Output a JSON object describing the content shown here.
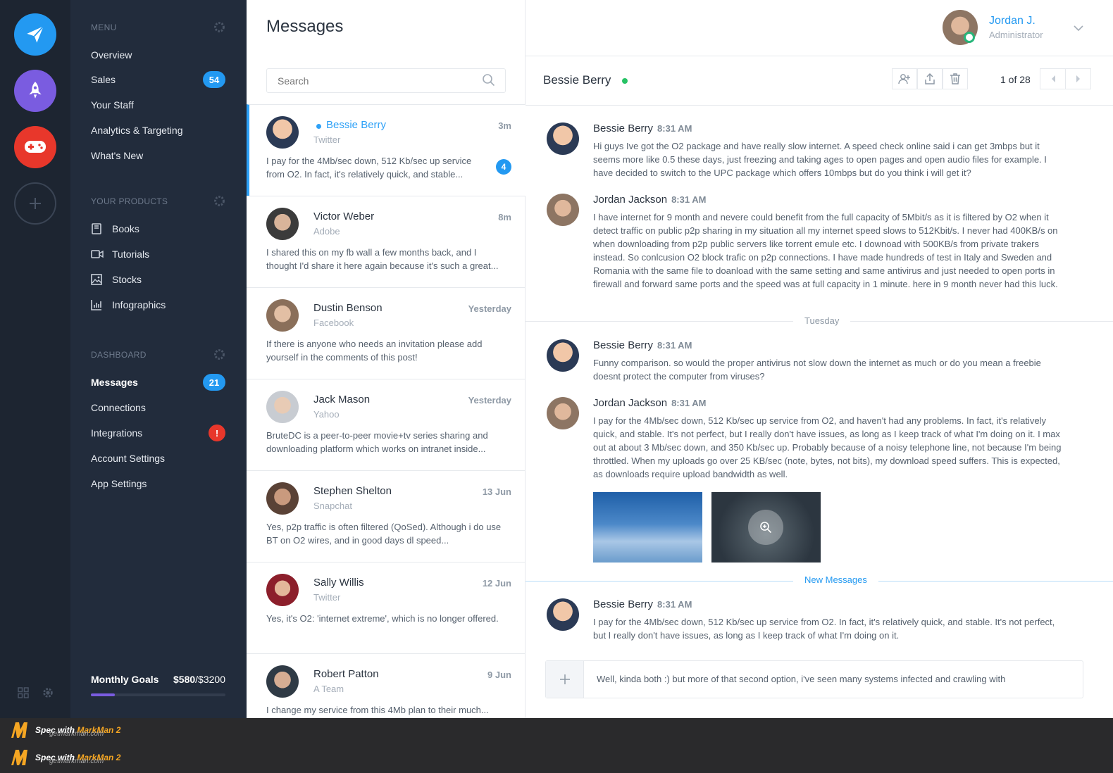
{
  "rail": {
    "buttons": [
      {
        "name": "send",
        "color": "#2399f1"
      },
      {
        "name": "rocket",
        "color": "#7a5ce0"
      },
      {
        "name": "gamepad",
        "color": "#e8372b"
      },
      {
        "name": "add"
      }
    ]
  },
  "nav": {
    "menu_header": "MENU",
    "menu_items": [
      "Overview",
      "Sales",
      "Your Staff",
      "Analytics & Targeting",
      "What's New"
    ],
    "sales_badge": "54",
    "products_header": "YOUR PRODUCTS",
    "product_items": [
      "Books",
      "Tutorials",
      "Stocks",
      "Infographics"
    ],
    "dashboard_header": "DASHBOARD",
    "dashboard_items": [
      "Messages",
      "Connections",
      "Integrations",
      "Account Settings",
      "App Settings"
    ],
    "messages_badge": "21",
    "integrations_badge": "!",
    "goals_label": "Monthly Goals",
    "goals_current": "$580",
    "goals_target": "/$3200",
    "goals_progress": 0.18
  },
  "list": {
    "title": "Messages",
    "search_placeholder": "Search",
    "conversations": [
      {
        "name": "Bessie Berry",
        "source": "Twitter",
        "time": "3m",
        "snippet": "I pay for the 4Mb/sec down, 512 Kb/sec up service from O2. In fact, it's relatively quick, and stable...",
        "count": "4"
      },
      {
        "name": "Victor Weber",
        "source": "Adobe",
        "time": "8m",
        "snippet": "I shared this on my fb wall a few months back, and I thought I'd share it here again because it's such a great..."
      },
      {
        "name": "Dustin Benson",
        "source": "Facebook",
        "time": "Yesterday",
        "snippet": "If there is anyone who needs an invitation please add yourself in the comments of this post!"
      },
      {
        "name": "Jack Mason",
        "source": "Yahoo",
        "time": "Yesterday",
        "snippet": "BruteDC is a peer-to-peer movie+tv series sharing and downloading platform which works on intranet inside..."
      },
      {
        "name": "Stephen Shelton",
        "source": "Snapchat",
        "time": "13 Jun",
        "snippet": "Yes, p2p traffic is often filtered (QoSed). Although i do use BT on O2 wires, and in good days dl speed..."
      },
      {
        "name": "Sally Willis",
        "source": "Twitter",
        "time": "12 Jun",
        "snippet": "Yes, it's O2: 'internet extreme', which is no longer offered."
      },
      {
        "name": "Robert Patton",
        "source": "A Team",
        "time": "9 Jun",
        "snippet": "I change my service from this 4Mb plan to their much..."
      }
    ]
  },
  "user": {
    "name": "Jordan J.",
    "role": "Administrator"
  },
  "conversation": {
    "contact": "Bessie Berry",
    "pager": "1 of 28",
    "day_divider": "Tuesday",
    "new_divider": "New Messages",
    "messages": [
      {
        "author": "Bessie Berry",
        "time": "8:31 AM",
        "text": "Hi guys Ive got the O2 package and have really slow internet. A speed check online said i can get 3mbps but it seems more like 0.5 these days, just freezing and taking ages to open pages and open audio files for example. I have decided to switch to the UPC package which offers 10mbps but do you think i will get it?"
      },
      {
        "author": "Jordan Jackson",
        "time": "8:31 AM",
        "text": "I have internet for 9 month and nevere could benefit from the full capacity of 5Mbit/s as it is filtered by O2 when it detect traffic on public p2p sharing in my situation all my internet speed slows to 512Kbit/s. I never had 400KB/s on when downloading from p2p public servers like torrent emule etc. I downoad with 500KB/s from private trakers instead. So conlcusion O2 block trafic on p2p connections. I have made hundreds of test in Italy and Sweden and Romania with the same file to doanload with the same setting and same antivirus and just needed to open ports in firewall and forward same ports and the speed was at full capacity in 1 minute. here in 9 month never had this luck."
      },
      {
        "author": "Bessie Berry",
        "time": "8:31 AM",
        "text": "Funny comparison. so would the proper antivirus not slow down the internet as much or do you mean a freebie doesnt protect the computer from viruses?"
      },
      {
        "author": "Jordan Jackson",
        "time": "8:31 AM",
        "text": "I pay for the 4Mb/sec down, 512 Kb/sec up service from O2, and haven't had any problems. In fact, it's relatively quick, and stable. It's not perfect, but I really don't have issues, as long as I keep track of what I'm doing on it. I max out at about 3 Mb/sec down, and 350 Kb/sec up. Probably because of a noisy telephone line, not because I'm being throttled. When my uploads go over 25 KB/sec (note, bytes, not bits), my download speed suffers. This is expected, as downloads require upload bandwidth as well."
      },
      {
        "author": "Bessie Berry",
        "time": "8:31 AM",
        "text": "I pay for the 4Mb/sec down, 512 Kb/sec up service from O2. In fact, it's relatively quick, and stable. It's not perfect, but I really don't have issues, as long as I keep track of what I'm doing on it."
      }
    ],
    "composer_text": "Well, kinda both :) but more of that second option, i've seen many systems infected and crawling with"
  },
  "footer": {
    "brand_prefix": "Spec with ",
    "brand_name": "MarkMan 2",
    "brand_url": "getmarkman.com"
  },
  "colors": {
    "accent": "#2399f1",
    "active_border": "#2ea1f7",
    "rail_bg": "#1d2531",
    "nav_bg": "#222c3c",
    "composer_plus_bg": "#f3f5f8"
  }
}
